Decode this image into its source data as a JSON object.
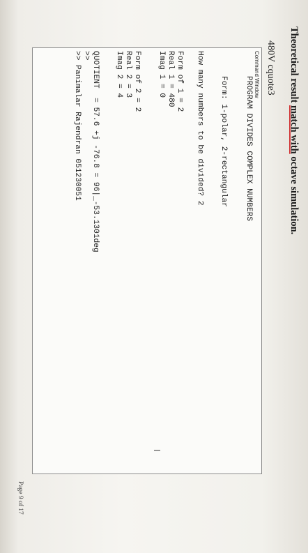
{
  "document": {
    "title_before": "Theoretical result ",
    "title_underlined": "match with",
    "title_after": " octave simulation.",
    "subheading": "480V  cquote3",
    "page_number": "Page 9 of 17"
  },
  "command_window": {
    "header": "Command Window",
    "lines": [
      "PROGRAM DIVIDES COMPLEX NUMBERS",
      "Form: 1-polar, 2-rectangular",
      "How many numbers to be divided? 2",
      "Form of 1 = 2",
      "Real 1 = 480",
      "Imag 1 = 0",
      "Form of 2 = 2",
      "Real 2 = 3",
      "Imag 2 = 4",
      "QUOTIENT  = 57.6 +j -76.8 = 96|_-53.1301deg",
      ">>",
      ">> Panimalar Rajendran 051230051"
    ],
    "cursor_icon": "text-cursor-icon"
  }
}
